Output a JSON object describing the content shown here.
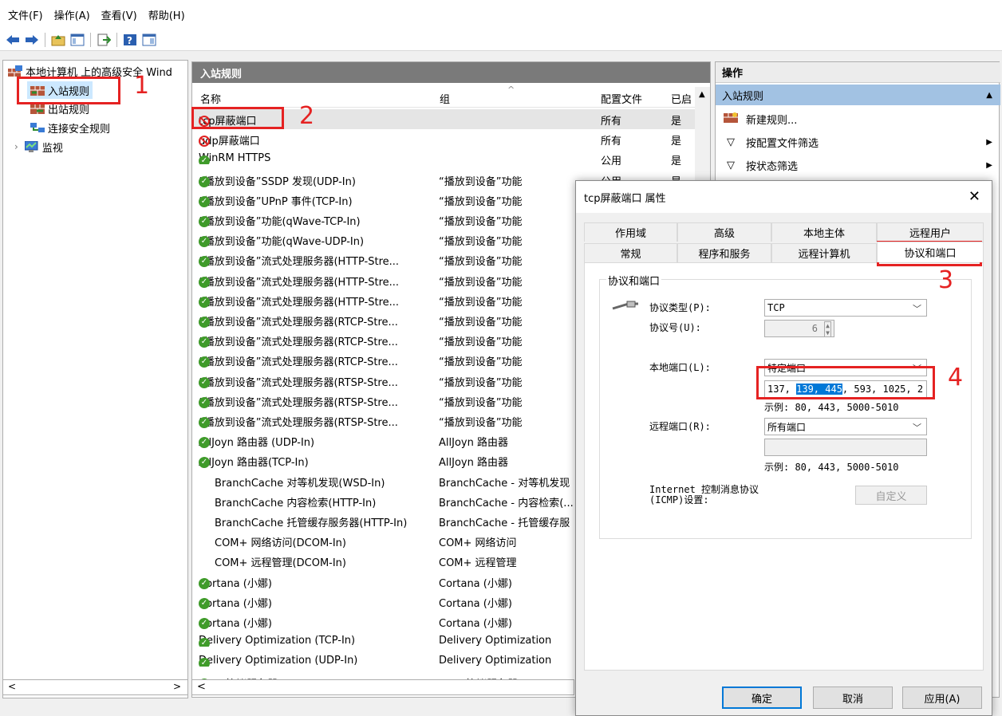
{
  "menu": [
    "文件(F)",
    "操作(A)",
    "查看(V)",
    "帮助(H)"
  ],
  "tree": {
    "root": "本地计算机 上的高级安全 Wind",
    "items": [
      "入站规则",
      "出站规则",
      "连接安全规则",
      "监视"
    ]
  },
  "list": {
    "title": "入站规则",
    "columns": {
      "name": "名称",
      "group": "组",
      "profile": "配置文件",
      "enabled": "已启"
    },
    "rows": [
      {
        "name": "tcp屏蔽端口",
        "group": "",
        "profile": "所有",
        "enabled": "是",
        "icon": "block"
      },
      {
        "name": "udp屏蔽端口",
        "group": "",
        "profile": "所有",
        "enabled": "是",
        "icon": "block"
      },
      {
        "name": "WinRM HTTPS",
        "group": "",
        "profile": "公用",
        "enabled": "是",
        "icon": "ok"
      },
      {
        "name": "“播放到设备”SSDP 发现(UDP-In)",
        "group": "“播放到设备”功能",
        "profile": "公用",
        "enabled": "是",
        "icon": "ok"
      },
      {
        "name": "“播放到设备”UPnP 事件(TCP-In)",
        "group": "“播放到设备”功能",
        "profile": "",
        "enabled": "",
        "icon": "ok"
      },
      {
        "name": "“播放到设备”功能(qWave-TCP-In)",
        "group": "“播放到设备”功能",
        "profile": "",
        "enabled": "",
        "icon": "ok"
      },
      {
        "name": "“播放到设备”功能(qWave-UDP-In)",
        "group": "“播放到设备”功能",
        "profile": "",
        "enabled": "",
        "icon": "ok"
      },
      {
        "name": "“播放到设备”流式处理服务器(HTTP-Stre...",
        "group": "“播放到设备”功能",
        "profile": "",
        "enabled": "",
        "icon": "ok"
      },
      {
        "name": "“播放到设备”流式处理服务器(HTTP-Stre...",
        "group": "“播放到设备”功能",
        "profile": "",
        "enabled": "",
        "icon": "ok"
      },
      {
        "name": "“播放到设备”流式处理服务器(HTTP-Stre...",
        "group": "“播放到设备”功能",
        "profile": "",
        "enabled": "",
        "icon": "ok"
      },
      {
        "name": "“播放到设备”流式处理服务器(RTCP-Stre...",
        "group": "“播放到设备”功能",
        "profile": "",
        "enabled": "",
        "icon": "ok"
      },
      {
        "name": "“播放到设备”流式处理服务器(RTCP-Stre...",
        "group": "“播放到设备”功能",
        "profile": "",
        "enabled": "",
        "icon": "ok"
      },
      {
        "name": "“播放到设备”流式处理服务器(RTCP-Stre...",
        "group": "“播放到设备”功能",
        "profile": "",
        "enabled": "",
        "icon": "ok"
      },
      {
        "name": "“播放到设备”流式处理服务器(RTSP-Stre...",
        "group": "“播放到设备”功能",
        "profile": "",
        "enabled": "",
        "icon": "ok"
      },
      {
        "name": "“播放到设备”流式处理服务器(RTSP-Stre...",
        "group": "“播放到设备”功能",
        "profile": "",
        "enabled": "",
        "icon": "ok"
      },
      {
        "name": "“播放到设备”流式处理服务器(RTSP-Stre...",
        "group": "“播放到设备”功能",
        "profile": "",
        "enabled": "",
        "icon": "ok"
      },
      {
        "name": "AllJoyn 路由器 (UDP-In)",
        "group": "AllJoyn 路由器",
        "profile": "",
        "enabled": "",
        "icon": "ok"
      },
      {
        "name": "AllJoyn 路由器(TCP-In)",
        "group": "AllJoyn 路由器",
        "profile": "",
        "enabled": "",
        "icon": "ok"
      },
      {
        "name": "BranchCache 对等机发现(WSD-In)",
        "group": "BranchCache - 对等机发现",
        "profile": "",
        "enabled": "",
        "icon": "none"
      },
      {
        "name": "BranchCache 内容检索(HTTP-In)",
        "group": "BranchCache - 内容检索(...",
        "profile": "",
        "enabled": "",
        "icon": "none"
      },
      {
        "name": "BranchCache 托管缓存服务器(HTTP-In)",
        "group": "BranchCache - 托管缓存服",
        "profile": "",
        "enabled": "",
        "icon": "none"
      },
      {
        "name": "COM+ 网络访问(DCOM-In)",
        "group": "COM+ 网络访问",
        "profile": "",
        "enabled": "",
        "icon": "none"
      },
      {
        "name": "COM+ 远程管理(DCOM-In)",
        "group": "COM+ 远程管理",
        "profile": "",
        "enabled": "",
        "icon": "none"
      },
      {
        "name": "Cortana (小娜)",
        "group": "Cortana (小娜)",
        "profile": "",
        "enabled": "",
        "icon": "ok"
      },
      {
        "name": "Cortana (小娜)",
        "group": "Cortana (小娜)",
        "profile": "",
        "enabled": "",
        "icon": "ok"
      },
      {
        "name": "Cortana (小娜)",
        "group": "Cortana (小娜)",
        "profile": "",
        "enabled": "",
        "icon": "ok"
      },
      {
        "name": "Delivery Optimization (TCP-In)",
        "group": "Delivery Optimization",
        "profile": "",
        "enabled": "",
        "icon": "ok"
      },
      {
        "name": "Delivery Optimization (UDP-In)",
        "group": "Delivery Optimization",
        "profile": "",
        "enabled": "",
        "icon": "ok"
      },
      {
        "name": "DIAL 协议服务器(HTTP-In)",
        "group": "DIAL 协议服务器",
        "profile": "",
        "enabled": "",
        "icon": "ok"
      }
    ]
  },
  "actions": {
    "title": "操作",
    "section": "入站规则",
    "items": [
      "新建规则...",
      "按配置文件筛选",
      "按状态筛选"
    ]
  },
  "dialog": {
    "title": "tcp屏蔽端口 属性",
    "tabs_row1": [
      "作用域",
      "高级",
      "本地主体",
      "远程用户"
    ],
    "tabs_row2": [
      "常规",
      "程序和服务",
      "远程计算机",
      "协议和端口"
    ],
    "group_label": "协议和端口",
    "protocol_type_label": "协议类型(P):",
    "protocol_type_value": "TCP",
    "protocol_number_label": "协议号(U):",
    "protocol_number_value": "6",
    "local_port_label": "本地端口(L):",
    "local_port_value": "特定端口",
    "local_port_entry_prefix": "137, ",
    "local_port_entry_selected": "139, 445",
    "local_port_entry_suffix": ", 593, 1025, 2",
    "local_port_example": "示例: 80, 443, 5000-5010",
    "remote_port_label": "远程端口(R):",
    "remote_port_value": "所有端口",
    "remote_port_example": "示例: 80, 443, 5000-5010",
    "icmp_label": "Internet 控制消息协议(ICMP)设置:",
    "customize_button": "自定义",
    "ok_button": "确定",
    "cancel_button": "取消",
    "apply_button": "应用(A)"
  },
  "annotations": [
    "1",
    "2",
    "3",
    "4"
  ],
  "colors": {
    "annotation_red": "#e52222",
    "selection_blue": "#0078d7",
    "action_header": "#a2c2e3"
  }
}
